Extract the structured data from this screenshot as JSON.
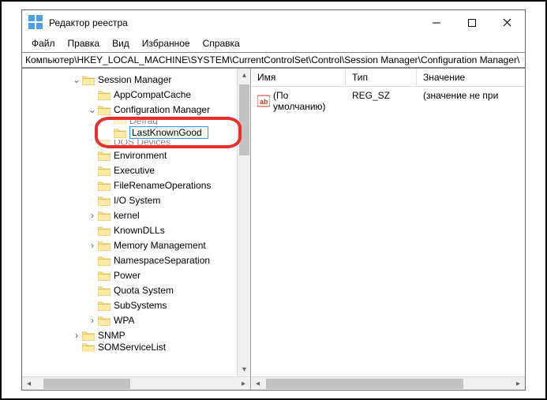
{
  "window": {
    "title": "Редактор реестра"
  },
  "menu": {
    "file": "Файл",
    "edit": "Правка",
    "view": "Вид",
    "favorites": "Избранное",
    "help": "Справка"
  },
  "address": "Компьютер\\HKEY_LOCAL_MACHINE\\SYSTEM\\CurrentControlSet\\Control\\Session Manager\\Configuration Manager\\",
  "tree": {
    "session_manager": "Session Manager",
    "appcompatcache": "AppCompatCache",
    "configuration_manager": "Configuration Manager",
    "defrag_cut": "Defrag",
    "rename_value": "LastKnownGood",
    "dos_devices_cut": "DOS Devices",
    "environment": "Environment",
    "executive": "Executive",
    "filerenameops": "FileRenameOperations",
    "iosystem": "I/O System",
    "kernel": "kernel",
    "knowndlls": "KnownDLLs",
    "memman": "Memory Management",
    "nss": "NamespaceSeparation",
    "power": "Power",
    "quota": "Quota System",
    "subsystems": "SubSystems",
    "wpa": "WPA",
    "snmp": "SNMP",
    "last_cut": "SOMServiceList"
  },
  "list": {
    "headers": {
      "name": "Имя",
      "type": "Тип",
      "value": "Значение"
    },
    "row0": {
      "name": "(По умолчанию)",
      "type": "REG_SZ",
      "value": "(значение не при"
    }
  }
}
